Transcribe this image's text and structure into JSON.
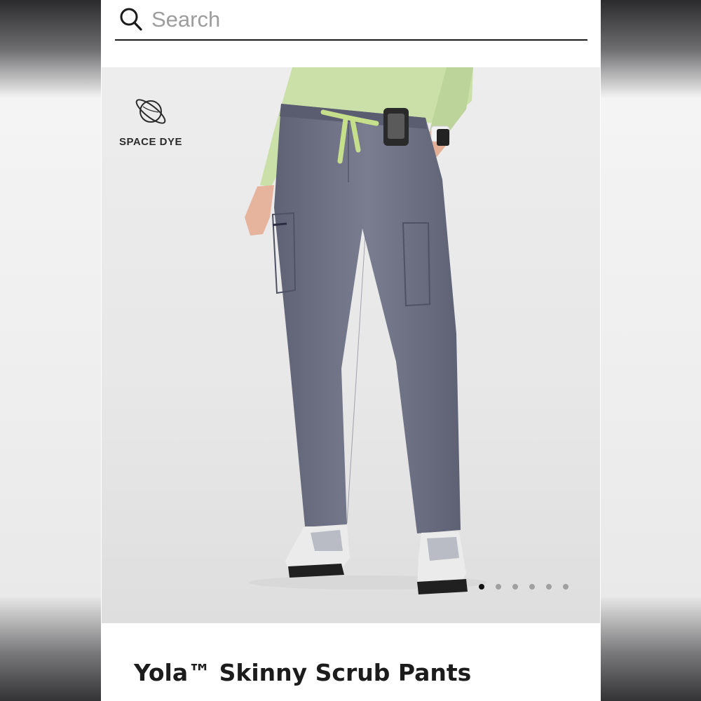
{
  "search": {
    "placeholder": "Search",
    "icon": "search-icon"
  },
  "hero": {
    "badge": {
      "icon": "planet-icon",
      "label": "SPACE DYE"
    },
    "carousel": {
      "total_images": 6,
      "active_index": 0
    }
  },
  "product": {
    "title": "Yola™ Skinny Scrub Pants"
  },
  "colors": {
    "pants": "#6f7285",
    "top": "#cbe0a8",
    "drawstring": "#c6df8a",
    "dot_active": "#111111",
    "dot_inactive": "#a0a0a0"
  }
}
